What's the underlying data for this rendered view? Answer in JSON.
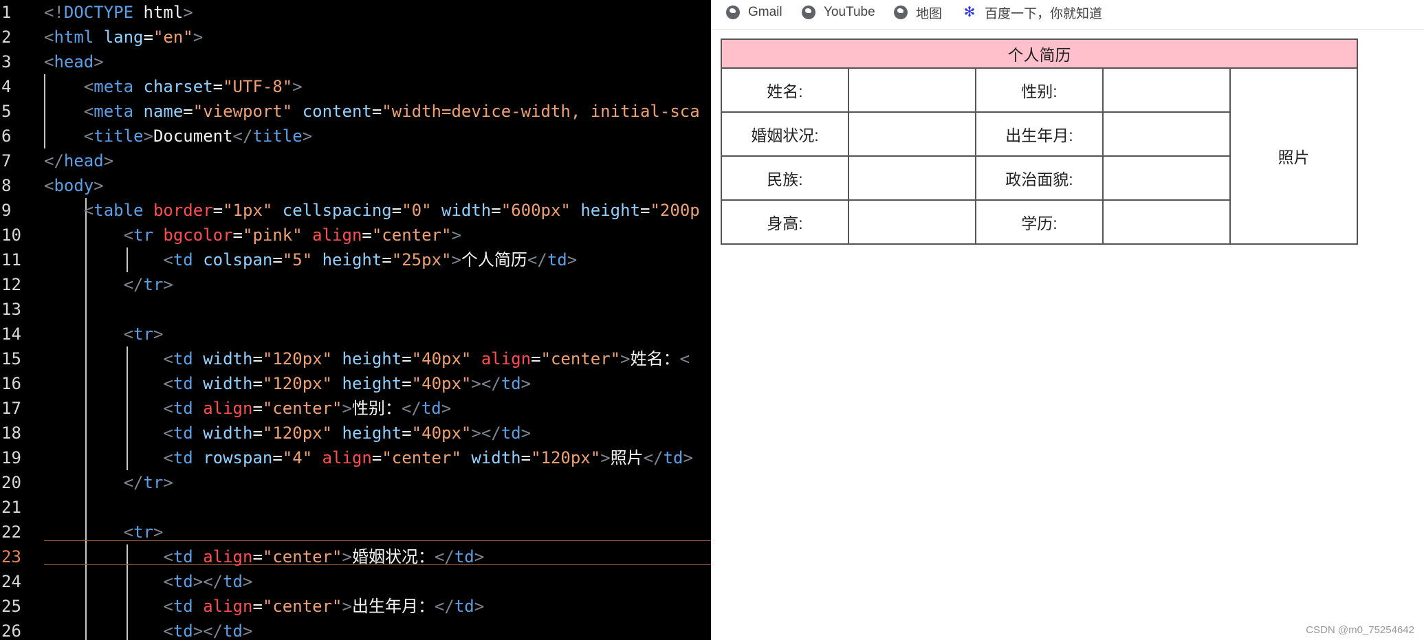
{
  "editor": {
    "line_numbers": [
      "1",
      "2",
      "3",
      "4",
      "5",
      "6",
      "7",
      "8",
      "9",
      "10",
      "11",
      "12",
      "13",
      "14",
      "15",
      "16",
      "17",
      "18",
      "19",
      "20",
      "21",
      "22",
      "23",
      "24",
      "25",
      "26"
    ],
    "active_line": "23",
    "lines": [
      [
        {
          "c": "t",
          "v": "<!"
        },
        {
          "c": "g",
          "v": "DOCTYPE"
        },
        {
          "c": "w",
          "v": " html"
        },
        {
          "c": "t",
          "v": ">"
        }
      ],
      [
        {
          "c": "t",
          "v": "<"
        },
        {
          "c": "g",
          "v": "html"
        },
        {
          "c": "a",
          "v": " lang"
        },
        {
          "c": "w",
          "v": "="
        },
        {
          "c": "s",
          "v": "\"en\""
        },
        {
          "c": "t",
          "v": ">"
        }
      ],
      [
        {
          "c": "t",
          "v": "<"
        },
        {
          "c": "g",
          "v": "head"
        },
        {
          "c": "t",
          "v": ">"
        }
      ],
      [
        {
          "c": "w",
          "v": "    "
        },
        {
          "c": "t",
          "v": "<"
        },
        {
          "c": "g",
          "v": "meta"
        },
        {
          "c": "a",
          "v": " charset"
        },
        {
          "c": "w",
          "v": "="
        },
        {
          "c": "s",
          "v": "\"UTF-8\""
        },
        {
          "c": "t",
          "v": ">"
        }
      ],
      [
        {
          "c": "w",
          "v": "    "
        },
        {
          "c": "t",
          "v": "<"
        },
        {
          "c": "g",
          "v": "meta"
        },
        {
          "c": "a",
          "v": " name"
        },
        {
          "c": "w",
          "v": "="
        },
        {
          "c": "s",
          "v": "\"viewport\""
        },
        {
          "c": "a",
          "v": " content"
        },
        {
          "c": "w",
          "v": "="
        },
        {
          "c": "s",
          "v": "\"width=device-width, initial-sca"
        }
      ],
      [
        {
          "c": "w",
          "v": "    "
        },
        {
          "c": "t",
          "v": "<"
        },
        {
          "c": "g",
          "v": "title"
        },
        {
          "c": "t",
          "v": ">"
        },
        {
          "c": "w",
          "v": "Document"
        },
        {
          "c": "t",
          "v": "</"
        },
        {
          "c": "g",
          "v": "title"
        },
        {
          "c": "t",
          "v": ">"
        }
      ],
      [
        {
          "c": "t",
          "v": "</"
        },
        {
          "c": "g",
          "v": "head"
        },
        {
          "c": "t",
          "v": ">"
        }
      ],
      [
        {
          "c": "t",
          "v": "<"
        },
        {
          "c": "g",
          "v": "body"
        },
        {
          "c": "t",
          "v": ">"
        }
      ],
      [
        {
          "c": "w",
          "v": "    "
        },
        {
          "c": "t",
          "v": "<"
        },
        {
          "c": "g",
          "v": "table"
        },
        {
          "c": "r",
          "v": " border"
        },
        {
          "c": "w",
          "v": "="
        },
        {
          "c": "s",
          "v": "\"1px\""
        },
        {
          "c": "a",
          "v": " cellspacing"
        },
        {
          "c": "w",
          "v": "="
        },
        {
          "c": "s",
          "v": "\"0\""
        },
        {
          "c": "a",
          "v": " width"
        },
        {
          "c": "w",
          "v": "="
        },
        {
          "c": "s",
          "v": "\"600px\""
        },
        {
          "c": "a",
          "v": " height"
        },
        {
          "c": "w",
          "v": "="
        },
        {
          "c": "s",
          "v": "\"200p"
        }
      ],
      [
        {
          "c": "w",
          "v": "        "
        },
        {
          "c": "t",
          "v": "<"
        },
        {
          "c": "g",
          "v": "tr"
        },
        {
          "c": "r",
          "v": " bgcolor"
        },
        {
          "c": "w",
          "v": "="
        },
        {
          "c": "s",
          "v": "\"pink\""
        },
        {
          "c": "r",
          "v": " align"
        },
        {
          "c": "w",
          "v": "="
        },
        {
          "c": "s",
          "v": "\"center\""
        },
        {
          "c": "t",
          "v": ">"
        }
      ],
      [
        {
          "c": "w",
          "v": "            "
        },
        {
          "c": "t",
          "v": "<"
        },
        {
          "c": "g",
          "v": "td"
        },
        {
          "c": "a",
          "v": " colspan"
        },
        {
          "c": "w",
          "v": "="
        },
        {
          "c": "s",
          "v": "\"5\""
        },
        {
          "c": "a",
          "v": " height"
        },
        {
          "c": "w",
          "v": "="
        },
        {
          "c": "s",
          "v": "\"25px\""
        },
        {
          "c": "t",
          "v": ">"
        },
        {
          "c": "w",
          "v": "个人简历"
        },
        {
          "c": "t",
          "v": "</"
        },
        {
          "c": "g",
          "v": "td"
        },
        {
          "c": "t",
          "v": ">"
        }
      ],
      [
        {
          "c": "w",
          "v": "        "
        },
        {
          "c": "t",
          "v": "</"
        },
        {
          "c": "g",
          "v": "tr"
        },
        {
          "c": "t",
          "v": ">"
        }
      ],
      [],
      [
        {
          "c": "w",
          "v": "        "
        },
        {
          "c": "t",
          "v": "<"
        },
        {
          "c": "g",
          "v": "tr"
        },
        {
          "c": "t",
          "v": ">"
        }
      ],
      [
        {
          "c": "w",
          "v": "            "
        },
        {
          "c": "t",
          "v": "<"
        },
        {
          "c": "g",
          "v": "td"
        },
        {
          "c": "a",
          "v": " width"
        },
        {
          "c": "w",
          "v": "="
        },
        {
          "c": "s",
          "v": "\"120px\""
        },
        {
          "c": "a",
          "v": " height"
        },
        {
          "c": "w",
          "v": "="
        },
        {
          "c": "s",
          "v": "\"40px\""
        },
        {
          "c": "r",
          "v": " align"
        },
        {
          "c": "w",
          "v": "="
        },
        {
          "c": "s",
          "v": "\"center\""
        },
        {
          "c": "t",
          "v": ">"
        },
        {
          "c": "w",
          "v": "姓名："
        },
        {
          "c": "t",
          "v": "<"
        }
      ],
      [
        {
          "c": "w",
          "v": "            "
        },
        {
          "c": "t",
          "v": "<"
        },
        {
          "c": "g",
          "v": "td"
        },
        {
          "c": "a",
          "v": " width"
        },
        {
          "c": "w",
          "v": "="
        },
        {
          "c": "s",
          "v": "\"120px\""
        },
        {
          "c": "a",
          "v": " height"
        },
        {
          "c": "w",
          "v": "="
        },
        {
          "c": "s",
          "v": "\"40px\""
        },
        {
          "c": "t",
          "v": "></"
        },
        {
          "c": "g",
          "v": "td"
        },
        {
          "c": "t",
          "v": ">"
        }
      ],
      [
        {
          "c": "w",
          "v": "            "
        },
        {
          "c": "t",
          "v": "<"
        },
        {
          "c": "g",
          "v": "td"
        },
        {
          "c": "r",
          "v": " align"
        },
        {
          "c": "w",
          "v": "="
        },
        {
          "c": "s",
          "v": "\"center\""
        },
        {
          "c": "t",
          "v": ">"
        },
        {
          "c": "w",
          "v": "性别："
        },
        {
          "c": "t",
          "v": "</"
        },
        {
          "c": "g",
          "v": "td"
        },
        {
          "c": "t",
          "v": ">"
        }
      ],
      [
        {
          "c": "w",
          "v": "            "
        },
        {
          "c": "t",
          "v": "<"
        },
        {
          "c": "g",
          "v": "td"
        },
        {
          "c": "a",
          "v": " width"
        },
        {
          "c": "w",
          "v": "="
        },
        {
          "c": "s",
          "v": "\"120px\""
        },
        {
          "c": "a",
          "v": " height"
        },
        {
          "c": "w",
          "v": "="
        },
        {
          "c": "s",
          "v": "\"40px\""
        },
        {
          "c": "t",
          "v": "></"
        },
        {
          "c": "g",
          "v": "td"
        },
        {
          "c": "t",
          "v": ">"
        }
      ],
      [
        {
          "c": "w",
          "v": "            "
        },
        {
          "c": "t",
          "v": "<"
        },
        {
          "c": "g",
          "v": "td"
        },
        {
          "c": "a",
          "v": " rowspan"
        },
        {
          "c": "w",
          "v": "="
        },
        {
          "c": "s",
          "v": "\"4\""
        },
        {
          "c": "r",
          "v": " align"
        },
        {
          "c": "w",
          "v": "="
        },
        {
          "c": "s",
          "v": "\"center\""
        },
        {
          "c": "a",
          "v": " width"
        },
        {
          "c": "w",
          "v": "="
        },
        {
          "c": "s",
          "v": "\"120px\""
        },
        {
          "c": "t",
          "v": ">"
        },
        {
          "c": "w",
          "v": "照片"
        },
        {
          "c": "t",
          "v": "</"
        },
        {
          "c": "g",
          "v": "td"
        },
        {
          "c": "t",
          "v": ">"
        }
      ],
      [
        {
          "c": "w",
          "v": "        "
        },
        {
          "c": "t",
          "v": "</"
        },
        {
          "c": "g",
          "v": "tr"
        },
        {
          "c": "t",
          "v": ">"
        }
      ],
      [],
      [
        {
          "c": "w",
          "v": "        "
        },
        {
          "c": "t",
          "v": "<"
        },
        {
          "c": "g",
          "v": "tr"
        },
        {
          "c": "t",
          "v": ">"
        }
      ],
      [
        {
          "c": "w",
          "v": "            "
        },
        {
          "c": "t",
          "v": "<"
        },
        {
          "c": "g",
          "v": "td"
        },
        {
          "c": "r",
          "v": " align"
        },
        {
          "c": "w",
          "v": "="
        },
        {
          "c": "s",
          "v": "\"center\""
        },
        {
          "c": "t",
          "v": ">"
        },
        {
          "c": "w",
          "v": "婚姻状况："
        },
        {
          "c": "t",
          "v": "</"
        },
        {
          "c": "g",
          "v": "td"
        },
        {
          "c": "t",
          "v": ">"
        }
      ],
      [
        {
          "c": "w",
          "v": "            "
        },
        {
          "c": "t",
          "v": "<"
        },
        {
          "c": "g",
          "v": "td"
        },
        {
          "c": "t",
          "v": "></"
        },
        {
          "c": "g",
          "v": "td"
        },
        {
          "c": "t",
          "v": ">"
        }
      ],
      [
        {
          "c": "w",
          "v": "            "
        },
        {
          "c": "t",
          "v": "<"
        },
        {
          "c": "g",
          "v": "td"
        },
        {
          "c": "r",
          "v": " align"
        },
        {
          "c": "w",
          "v": "="
        },
        {
          "c": "s",
          "v": "\"center\""
        },
        {
          "c": "t",
          "v": ">"
        },
        {
          "c": "w",
          "v": "出生年月："
        },
        {
          "c": "t",
          "v": "</"
        },
        {
          "c": "g",
          "v": "td"
        },
        {
          "c": "t",
          "v": ">"
        }
      ],
      [
        {
          "c": "w",
          "v": "            "
        },
        {
          "c": "t",
          "v": "<"
        },
        {
          "c": "g",
          "v": "td"
        },
        {
          "c": "t",
          "v": "></"
        },
        {
          "c": "g",
          "v": "td"
        },
        {
          "c": "t",
          "v": ">"
        }
      ]
    ]
  },
  "bookmarks": [
    {
      "label": "Gmail",
      "icon": "globe-icon"
    },
    {
      "label": "YouTube",
      "icon": "globe-icon"
    },
    {
      "label": "地图",
      "icon": "globe-icon"
    },
    {
      "label": "百度一下，你就知道",
      "icon": "baidu-paw-icon"
    }
  ],
  "resume": {
    "title": "个人简历",
    "labels": {
      "name": "姓名:",
      "gender": "性别:",
      "marital": "婚姻状况:",
      "birth": "出生年月:",
      "ethnicity": "民族:",
      "political": "政治面貌:",
      "height": "身高:",
      "education": "学历:"
    },
    "photo": "照片",
    "header_color": "#ffc0cb"
  },
  "watermark": "CSDN @m0_75254642"
}
